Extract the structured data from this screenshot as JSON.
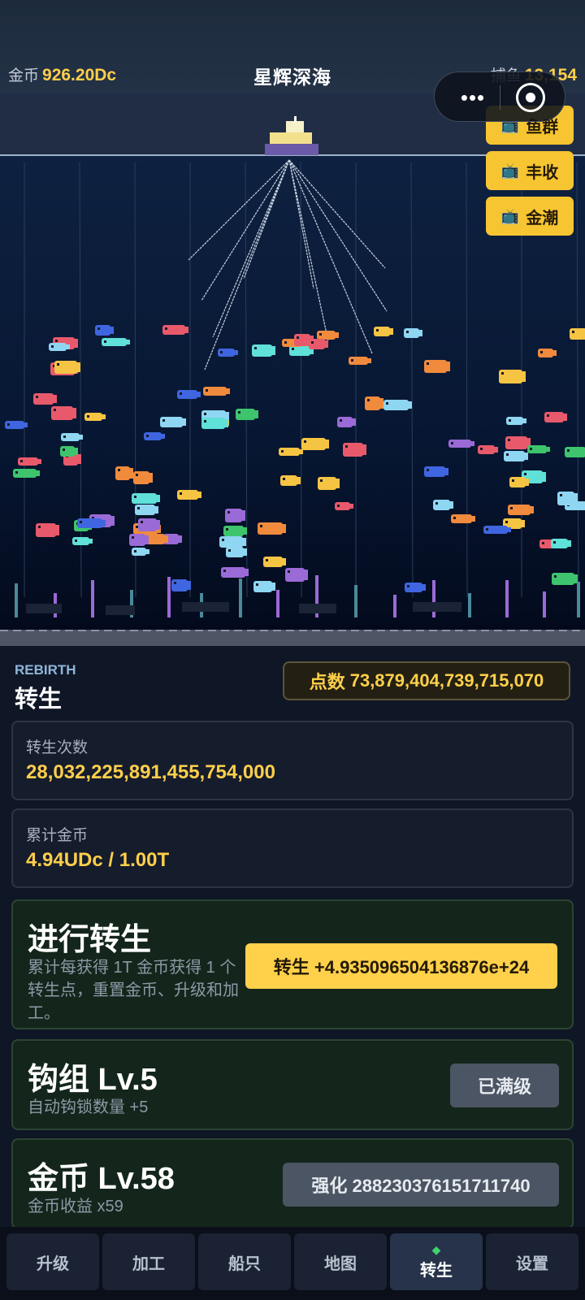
{
  "header": {
    "coin_label": "金币",
    "coin_value": "926.20Dc",
    "title": "星辉深海",
    "fish_label": "捕鱼",
    "fish_value": "13,154"
  },
  "capsule": {
    "more_icon": "more-dots-icon",
    "close_icon": "target-circle-icon"
  },
  "boosts": [
    {
      "icon": "tv-icon",
      "label": "鱼群"
    },
    {
      "icon": "tv-icon",
      "label": "丰收"
    },
    {
      "icon": "tv-icon",
      "label": "金潮"
    }
  ],
  "rebirth": {
    "section_en": "REBIRTH",
    "section_cn": "转生",
    "points_label": "点数",
    "points_value": "73,879,404,739,715,070",
    "count_label": "转生次数",
    "count_value": "28,032,225,891,455,754,000",
    "total_label": "累计金币",
    "total_value": "4.94UDc / 1.00T",
    "action_title": "进行转生",
    "action_desc": "累计每获得 1T 金币获得 1 个转生点，重置金币、升级和加工。",
    "action_button": "转生 +4.935096504136876e+24"
  },
  "upgrades": [
    {
      "title": "钩组 Lv.5",
      "desc": "自动钩锁数量 +5",
      "button": "已满级"
    },
    {
      "title": "金币 Lv.58",
      "desc": "金币收益 x59",
      "button": "强化 288230376151711740"
    }
  ],
  "nav": {
    "tabs": [
      "升级",
      "加工",
      "船只",
      "地图",
      "转生",
      "设置"
    ],
    "active": "转生",
    "active_icon": "◆"
  },
  "colors": {
    "accent": "#ffd04a",
    "gold_text": "#ffcf4a",
    "active_gem": "#3fd26d",
    "panel_bg": "#0f1626"
  }
}
